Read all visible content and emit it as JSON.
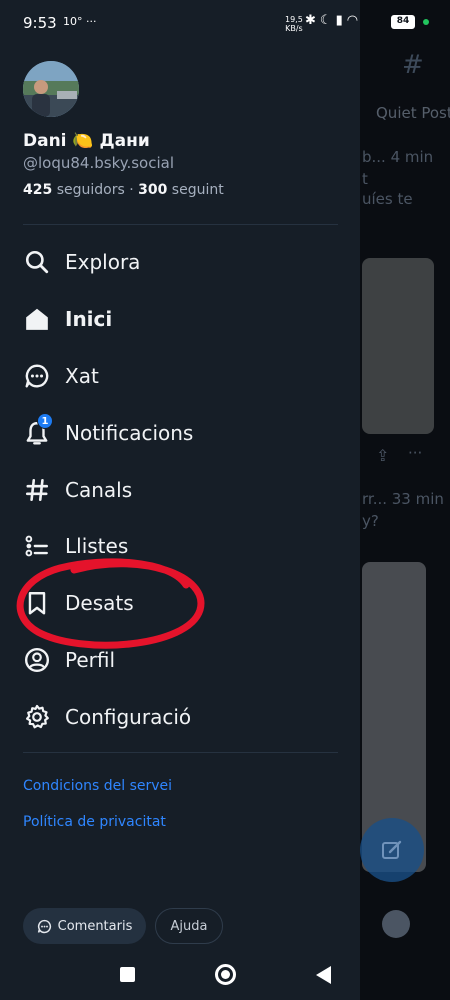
{
  "status_bar": {
    "time": "9:53",
    "temp": "10°",
    "more": "···",
    "net_rate_value": "19,5",
    "net_rate_unit": "KB/s",
    "battery": "84"
  },
  "background_feed": {
    "header_tab": "Quiet Post",
    "row1_meta": "b... 4 min",
    "row1_text": "t",
    "row1_text2": "uíes te",
    "row2_meta": "rr... 33 min",
    "row2_text": "y?"
  },
  "profile": {
    "display_name": "Dani 🍋 Дани",
    "handle": "@loqu84.bsky.social",
    "followers_count": "425",
    "followers_label": "seguidors",
    "separator": "·",
    "following_count": "300",
    "following_label": "seguint"
  },
  "nav": {
    "items": [
      {
        "label": "Explora",
        "icon": "search-icon"
      },
      {
        "label": "Inici",
        "icon": "home-icon",
        "active": true
      },
      {
        "label": "Xat",
        "icon": "chat-icon"
      },
      {
        "label": "Notificacions",
        "icon": "bell-icon",
        "badge": "1"
      },
      {
        "label": "Canals",
        "icon": "hashtag-icon"
      },
      {
        "label": "Llistes",
        "icon": "list-icon"
      },
      {
        "label": "Desats",
        "icon": "bookmark-icon"
      },
      {
        "label": "Perfil",
        "icon": "user-circle-icon"
      },
      {
        "label": "Configuració",
        "icon": "gear-icon"
      }
    ]
  },
  "links": {
    "terms": "Condicions del servei",
    "privacy": "Política de privacitat"
  },
  "footer": {
    "feedback": "Comentaris",
    "help": "Ajuda"
  },
  "colors": {
    "drawer_bg": "#161e27",
    "link": "#2f86ff",
    "badge": "#1d7bf2",
    "annotation": "#e5132b"
  }
}
